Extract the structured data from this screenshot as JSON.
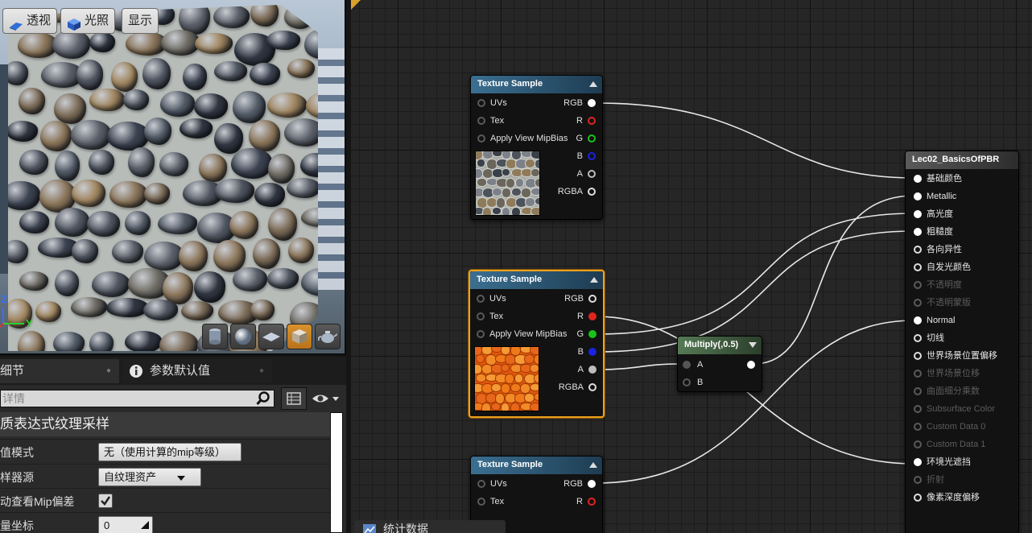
{
  "viewport": {
    "perspective_label": "透视",
    "lit_label": "光照",
    "show_label": "显示",
    "axis_z": "Z",
    "axis_y": "Y",
    "shape_buttons": [
      "cylinder",
      "sphere",
      "plane",
      "cube",
      "teapot"
    ],
    "active_shape": "cube"
  },
  "details": {
    "tab_details": "细节",
    "tab_params": "参数默认值",
    "search_placeholder": "详情",
    "section_title": "质表达式纹理采样",
    "rows": [
      {
        "label": "值模式",
        "value": "无（使用计算的mip等级）"
      },
      {
        "label": "样器源",
        "value": "自纹理资产"
      },
      {
        "label": "动查看Mip偏差",
        "value": ""
      },
      {
        "label": "量坐标",
        "value": "0"
      }
    ]
  },
  "graph": {
    "tex1": {
      "title": "Texture Sample",
      "inputs": [
        "UVs",
        "Tex",
        "Apply View MipBias"
      ],
      "outputs": [
        "RGB",
        "R",
        "G",
        "B",
        "A",
        "RGBA"
      ]
    },
    "tex2": {
      "title": "Texture Sample",
      "inputs": [
        "UVs",
        "Tex",
        "Apply View MipBias"
      ],
      "outputs": [
        "RGB",
        "R",
        "G",
        "B",
        "A",
        "RGBA"
      ]
    },
    "tex3": {
      "title": "Texture Sample",
      "inputs": [
        "UVs",
        "Tex"
      ],
      "outputs": [
        "RGB",
        "R"
      ]
    },
    "multiply": {
      "title": "Multiply(,0.5)",
      "inputs": [
        "A",
        "B"
      ]
    },
    "result": {
      "title": "Lec02_BasicsOfPBR",
      "pins": [
        {
          "label": "基础颜色",
          "enabled": true
        },
        {
          "label": "Metallic",
          "enabled": true
        },
        {
          "label": "高光度",
          "enabled": true
        },
        {
          "label": "粗糙度",
          "enabled": true
        },
        {
          "label": "各向异性",
          "enabled": true
        },
        {
          "label": "自发光颜色",
          "enabled": true
        },
        {
          "label": "不透明度",
          "enabled": false
        },
        {
          "label": "不透明蒙版",
          "enabled": false
        },
        {
          "label": "Normal",
          "enabled": true
        },
        {
          "label": "切线",
          "enabled": true
        },
        {
          "label": "世界场景位置偏移",
          "enabled": true
        },
        {
          "label": "世界场景位移",
          "enabled": false
        },
        {
          "label": "曲面细分乘数",
          "enabled": false
        },
        {
          "label": "Subsurface Color",
          "enabled": false
        },
        {
          "label": "Custom Data 0",
          "enabled": false
        },
        {
          "label": "Custom Data 1",
          "enabled": false
        },
        {
          "label": "环境光遮挡",
          "enabled": true
        },
        {
          "label": "折射",
          "enabled": false
        },
        {
          "label": "像素深度偏移",
          "enabled": true
        }
      ]
    }
  },
  "stats_tab": "统计数据",
  "colors": {
    "selection": "#f1a21b",
    "texture_header": "#3b6f91",
    "multiply_header": "#557a55",
    "pin_red": "#e0251c",
    "pin_green": "#18c21a",
    "pin_blue": "#1a23e0"
  }
}
